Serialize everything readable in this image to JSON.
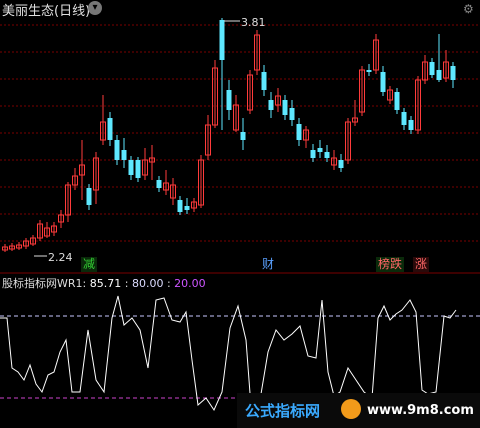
{
  "header": {
    "title": "美丽生态(日线)",
    "chevron_icon": "chevron-down-icon",
    "gear_icon": "settings-icon"
  },
  "price_chart": {
    "high_label": "3.81",
    "low_label": "2.24",
    "markers": [
      {
        "text": "减",
        "color": "#33cc33"
      },
      {
        "text": "财",
        "color": "#5aa0ff"
      },
      {
        "text": "榜跌",
        "color": "#ff6666"
      },
      {
        "text": "涨",
        "color": "#ff6666"
      }
    ]
  },
  "indicator": {
    "name": "股标指标网",
    "label": "WR1:",
    "wr1": "85.71",
    "sep1": ":",
    "v2": "80.00",
    "sep2": ":",
    "v3": "20.00"
  },
  "watermark": {
    "text": "公式指标网",
    "url": "www.9m8.com"
  },
  "colors": {
    "up": "#ff3b3b",
    "down": "#5ee8ff",
    "gridline": "#7a0000",
    "wr_line": "#ffffff",
    "level80": "#c8c8ff",
    "level20": "#cc44cc"
  }
}
